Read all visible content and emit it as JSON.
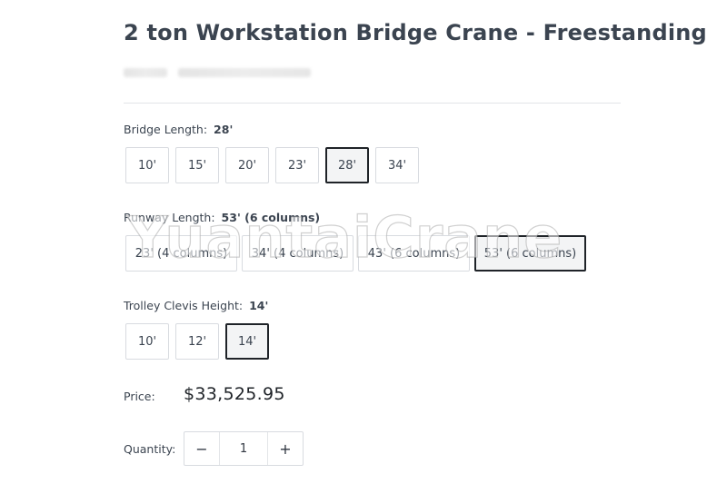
{
  "product": {
    "title": "2 ton Workstation Bridge Crane - Freestanding"
  },
  "options": {
    "bridge_length": {
      "label": "Bridge Length:",
      "selected": "28'",
      "choices": [
        "10'",
        "15'",
        "20'",
        "23'",
        "28'",
        "34'"
      ]
    },
    "runway_length": {
      "label": "Runway Length:",
      "selected": "53' (6 columns)",
      "choices": [
        "23' (4 columns)",
        "34' (4 columns)",
        "43' (6 columns)",
        "53' (6 columns)"
      ]
    },
    "trolley_clevis_height": {
      "label": "Trolley Clevis Height:",
      "selected": "14'",
      "choices": [
        "10'",
        "12'",
        "14'"
      ]
    }
  },
  "price": {
    "label": "Price:",
    "value": "$33,525.95"
  },
  "quantity": {
    "label": "Quantity:",
    "value": "1",
    "decrement_symbol": "−",
    "increment_symbol": "+"
  },
  "watermark": {
    "text": "YuantaiCrane"
  },
  "colors": {
    "text": "#3b4450",
    "selected_border": "#1f2328",
    "border": "#d8dbe0"
  }
}
